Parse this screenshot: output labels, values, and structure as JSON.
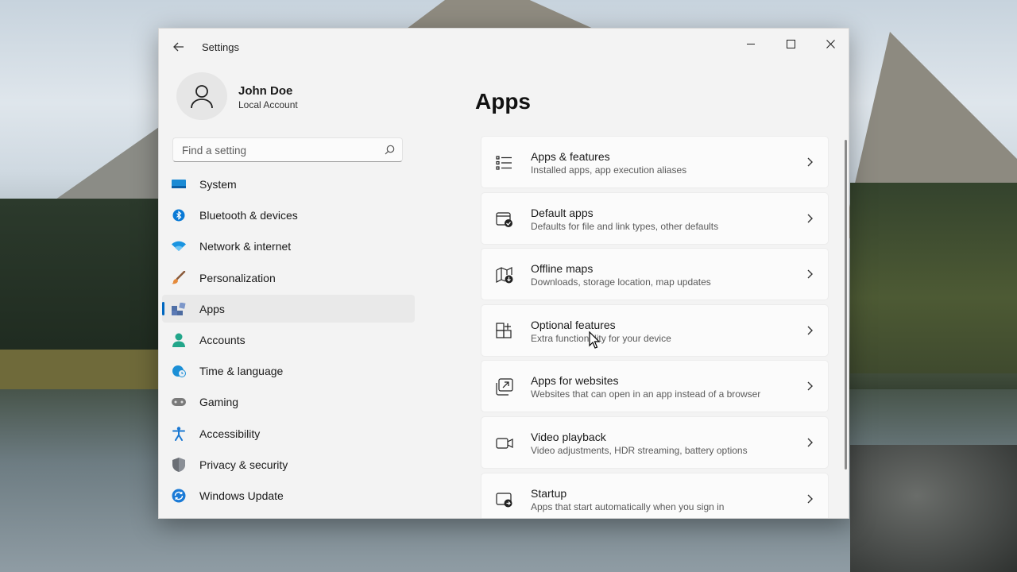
{
  "window": {
    "title": "Settings"
  },
  "profile": {
    "name": "John Doe",
    "account_type": "Local Account"
  },
  "search": {
    "placeholder": "Find a setting"
  },
  "nav": {
    "active": "Apps",
    "items": [
      {
        "label": "System",
        "icon": "monitor-icon",
        "color": "#1a8ad4"
      },
      {
        "label": "Bluetooth & devices",
        "icon": "bluetooth-icon",
        "color": "#0a7ad6"
      },
      {
        "label": "Network & internet",
        "icon": "wifi-icon",
        "color": "#1a94e0"
      },
      {
        "label": "Personalization",
        "icon": "paintbrush-icon",
        "color": "#c56b34"
      },
      {
        "label": "Apps",
        "icon": "apps-icon",
        "color": "#4f6fa6"
      },
      {
        "label": "Accounts",
        "icon": "person-icon",
        "color": "#22a68a"
      },
      {
        "label": "Time & language",
        "icon": "globe-clock-icon",
        "color": "#1b8fd6"
      },
      {
        "label": "Gaming",
        "icon": "gamepad-icon",
        "color": "#7a7a7a"
      },
      {
        "label": "Accessibility",
        "icon": "accessibility-icon",
        "color": "#1a78d2"
      },
      {
        "label": "Privacy & security",
        "icon": "shield-icon",
        "color": "#6b6f75"
      },
      {
        "label": "Windows Update",
        "icon": "sync-icon",
        "color": "#1a7ad6"
      }
    ]
  },
  "page": {
    "title": "Apps"
  },
  "cards": [
    {
      "title": "Apps & features",
      "subtitle": "Installed apps, app execution aliases",
      "icon": "list-icon"
    },
    {
      "title": "Default apps",
      "subtitle": "Defaults for file and link types, other defaults",
      "icon": "default-apps-icon"
    },
    {
      "title": "Offline maps",
      "subtitle": "Downloads, storage location, map updates",
      "icon": "map-download-icon"
    },
    {
      "title": "Optional features",
      "subtitle": "Extra functionality for your device",
      "icon": "add-grid-icon"
    },
    {
      "title": "Apps for websites",
      "subtitle": "Websites that can open in an app instead of a browser",
      "icon": "open-in-app-icon"
    },
    {
      "title": "Video playback",
      "subtitle": "Video adjustments, HDR streaming, battery options",
      "icon": "video-camera-icon"
    },
    {
      "title": "Startup",
      "subtitle": "Apps that start automatically when you sign in",
      "icon": "startup-icon"
    }
  ]
}
